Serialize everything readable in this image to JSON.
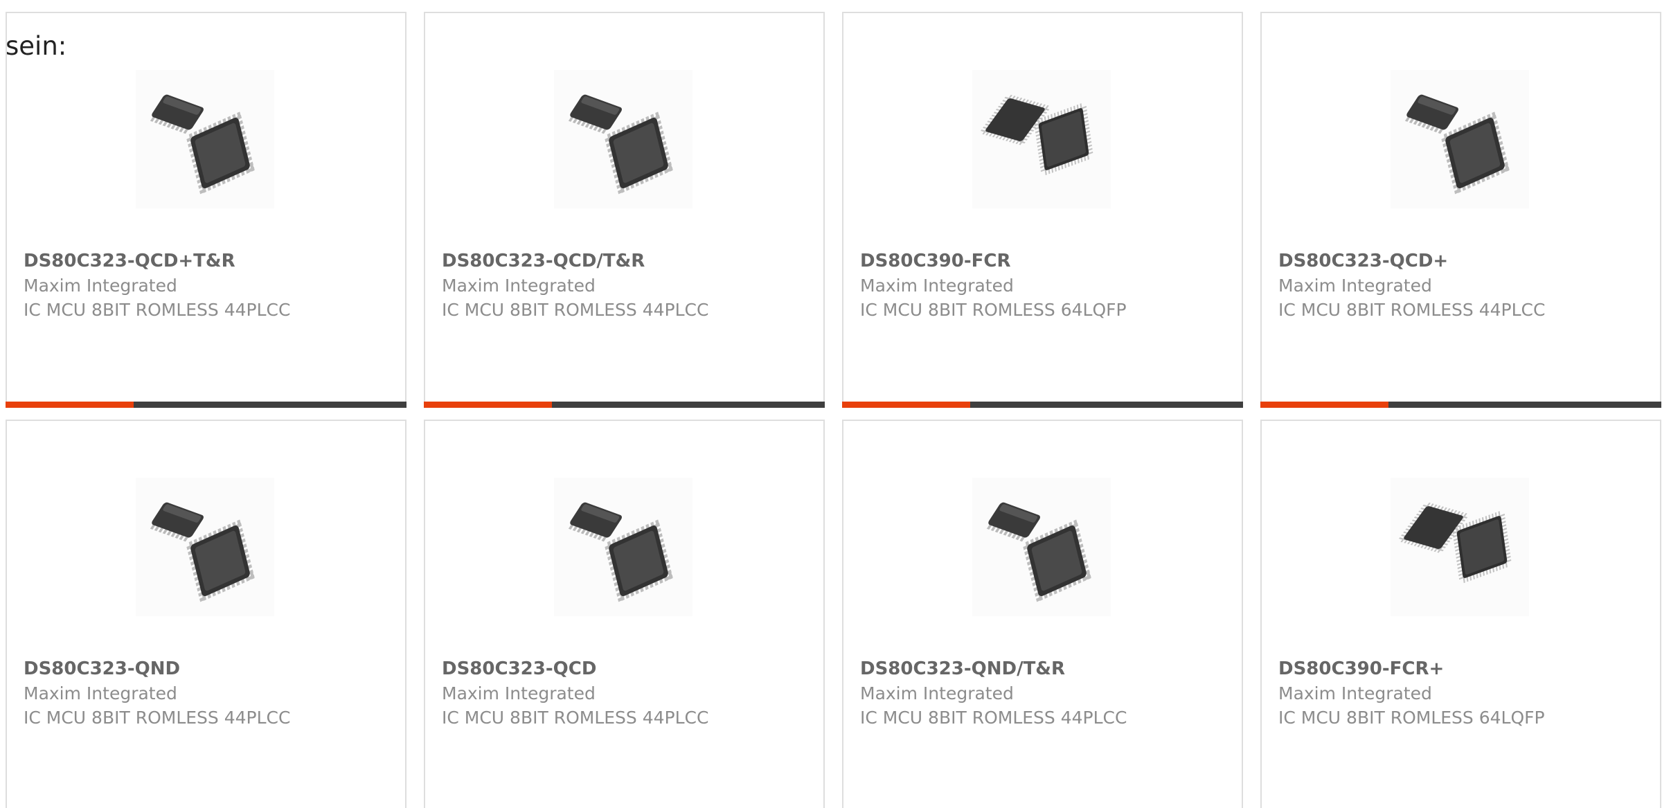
{
  "intro_text": "sein:",
  "colors": {
    "accent": "#e8400c",
    "bar_track": "#3f3f3f",
    "card_border": "#dedede"
  },
  "products": [
    {
      "part": "DS80C323-QCD+T&R",
      "manufacturer": "Maxim Integrated",
      "description": "IC MCU 8BIT ROMLESS 44PLCC",
      "image": "plcc44-chip-icon",
      "progress_fraction": 0.32
    },
    {
      "part": "DS80C323-QCD/T&R",
      "manufacturer": "Maxim Integrated",
      "description": "IC MCU 8BIT ROMLESS 44PLCC",
      "image": "plcc44-chip-icon",
      "progress_fraction": 0.32
    },
    {
      "part": "DS80C390-FCR",
      "manufacturer": "Maxim Integrated",
      "description": "IC MCU 8BIT ROMLESS 64LQFP",
      "image": "lqfp64-chip-icon",
      "progress_fraction": 0.32
    },
    {
      "part": "DS80C323-QCD+",
      "manufacturer": "Maxim Integrated",
      "description": "IC MCU 8BIT ROMLESS 44PLCC",
      "image": "plcc44-chip-icon",
      "progress_fraction": 0.32
    },
    {
      "part": "DS80C323-QND",
      "manufacturer": "Maxim Integrated",
      "description": "IC MCU 8BIT ROMLESS 44PLCC",
      "image": "plcc44-chip-icon",
      "progress_fraction": null
    },
    {
      "part": "DS80C323-QCD",
      "manufacturer": "Maxim Integrated",
      "description": "IC MCU 8BIT ROMLESS 44PLCC",
      "image": "plcc44-chip-icon",
      "progress_fraction": null
    },
    {
      "part": "DS80C323-QND/T&R",
      "manufacturer": "Maxim Integrated",
      "description": "IC MCU 8BIT ROMLESS 44PLCC",
      "image": "plcc44-chip-icon",
      "progress_fraction": null
    },
    {
      "part": "DS80C390-FCR+",
      "manufacturer": "Maxim Integrated",
      "description": "IC MCU 8BIT ROMLESS 64LQFP",
      "image": "lqfp64-chip-icon",
      "progress_fraction": null
    }
  ]
}
